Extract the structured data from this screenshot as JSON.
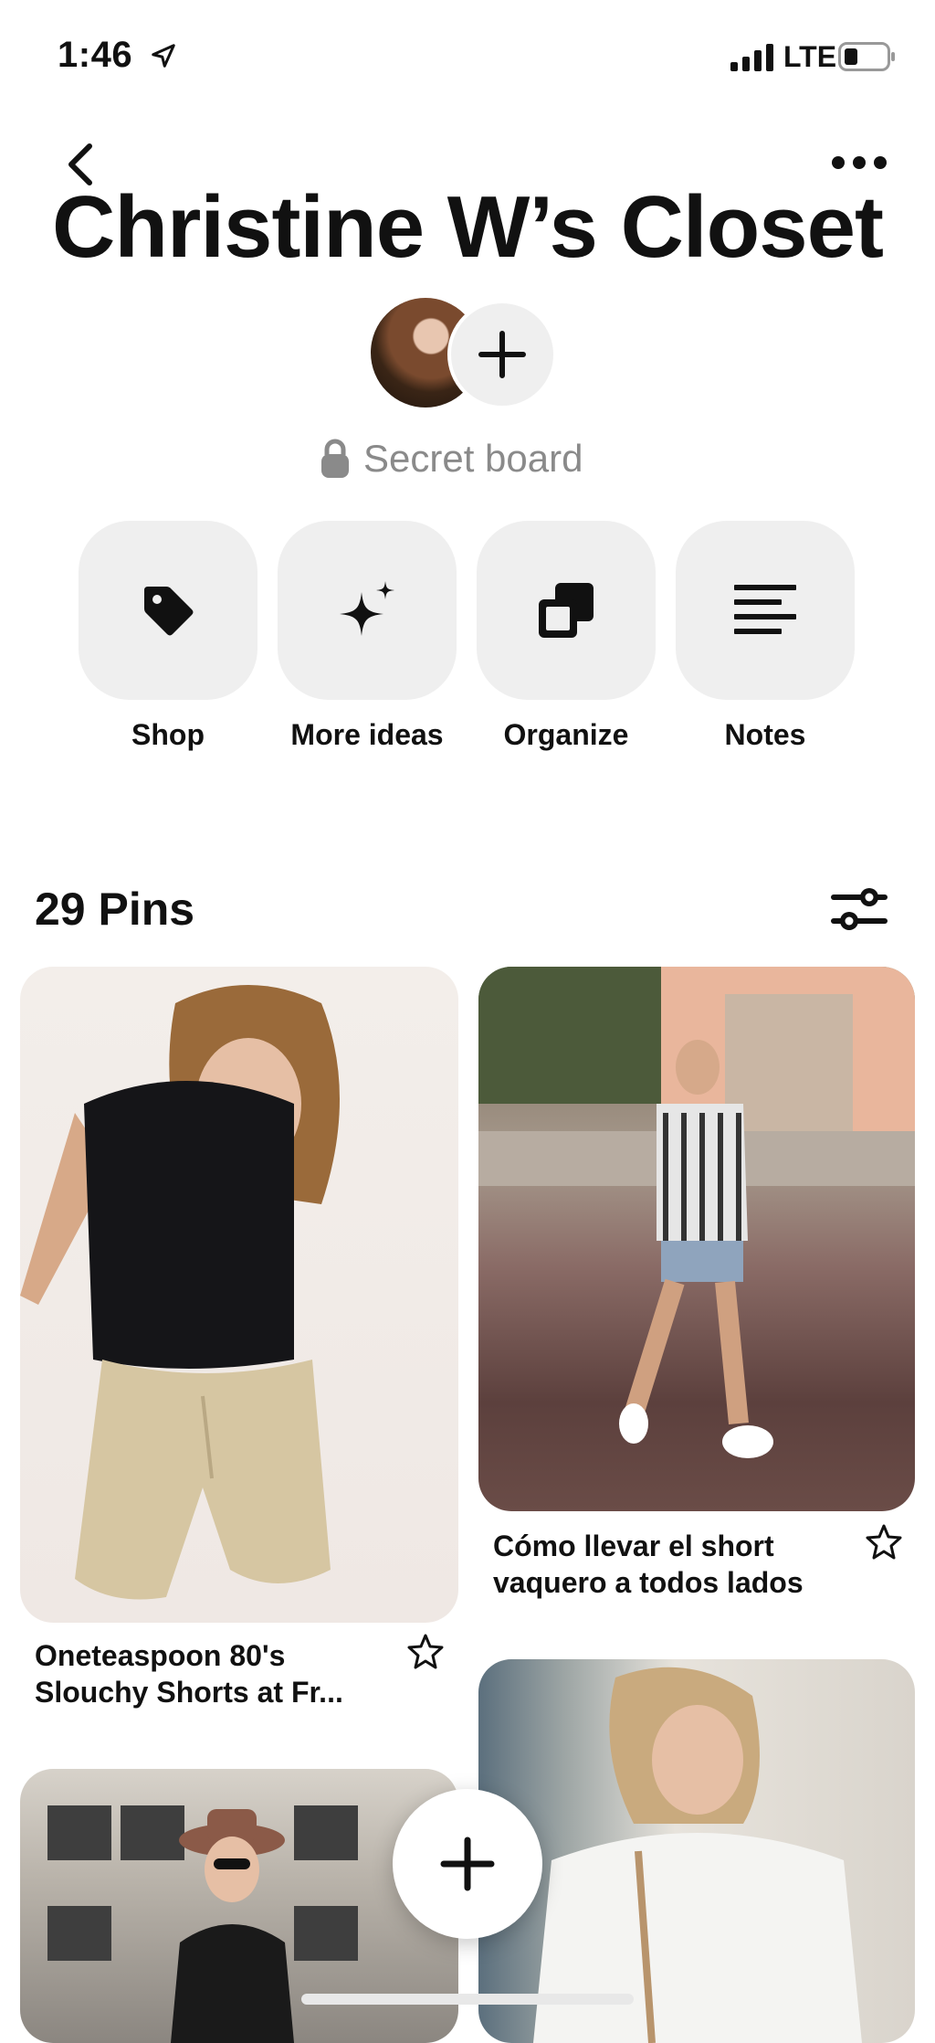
{
  "status_bar": {
    "time": "1:46",
    "network": "LTE"
  },
  "board": {
    "title": "Christine W’s Closet",
    "visibility_label": "Secret board"
  },
  "actions": [
    {
      "label": "Shop",
      "icon": "tag-icon"
    },
    {
      "label": "More ideas",
      "icon": "sparkle-icon"
    },
    {
      "label": "Organize",
      "icon": "organize-icon"
    },
    {
      "label": "Notes",
      "icon": "notes-icon"
    }
  ],
  "pins_header": {
    "count_label": "29 Pins"
  },
  "pins": [
    {
      "caption_line1": "Oneteaspoon 80's",
      "caption_line2": "Slouchy Shorts at Fr..."
    },
    {
      "caption_line1": "Cómo llevar el short",
      "caption_line2": "vaquero a todos lados"
    }
  ],
  "colors": {
    "tile_bg": "#efefef",
    "text": "#111111",
    "muted": "#8a8a8a"
  }
}
